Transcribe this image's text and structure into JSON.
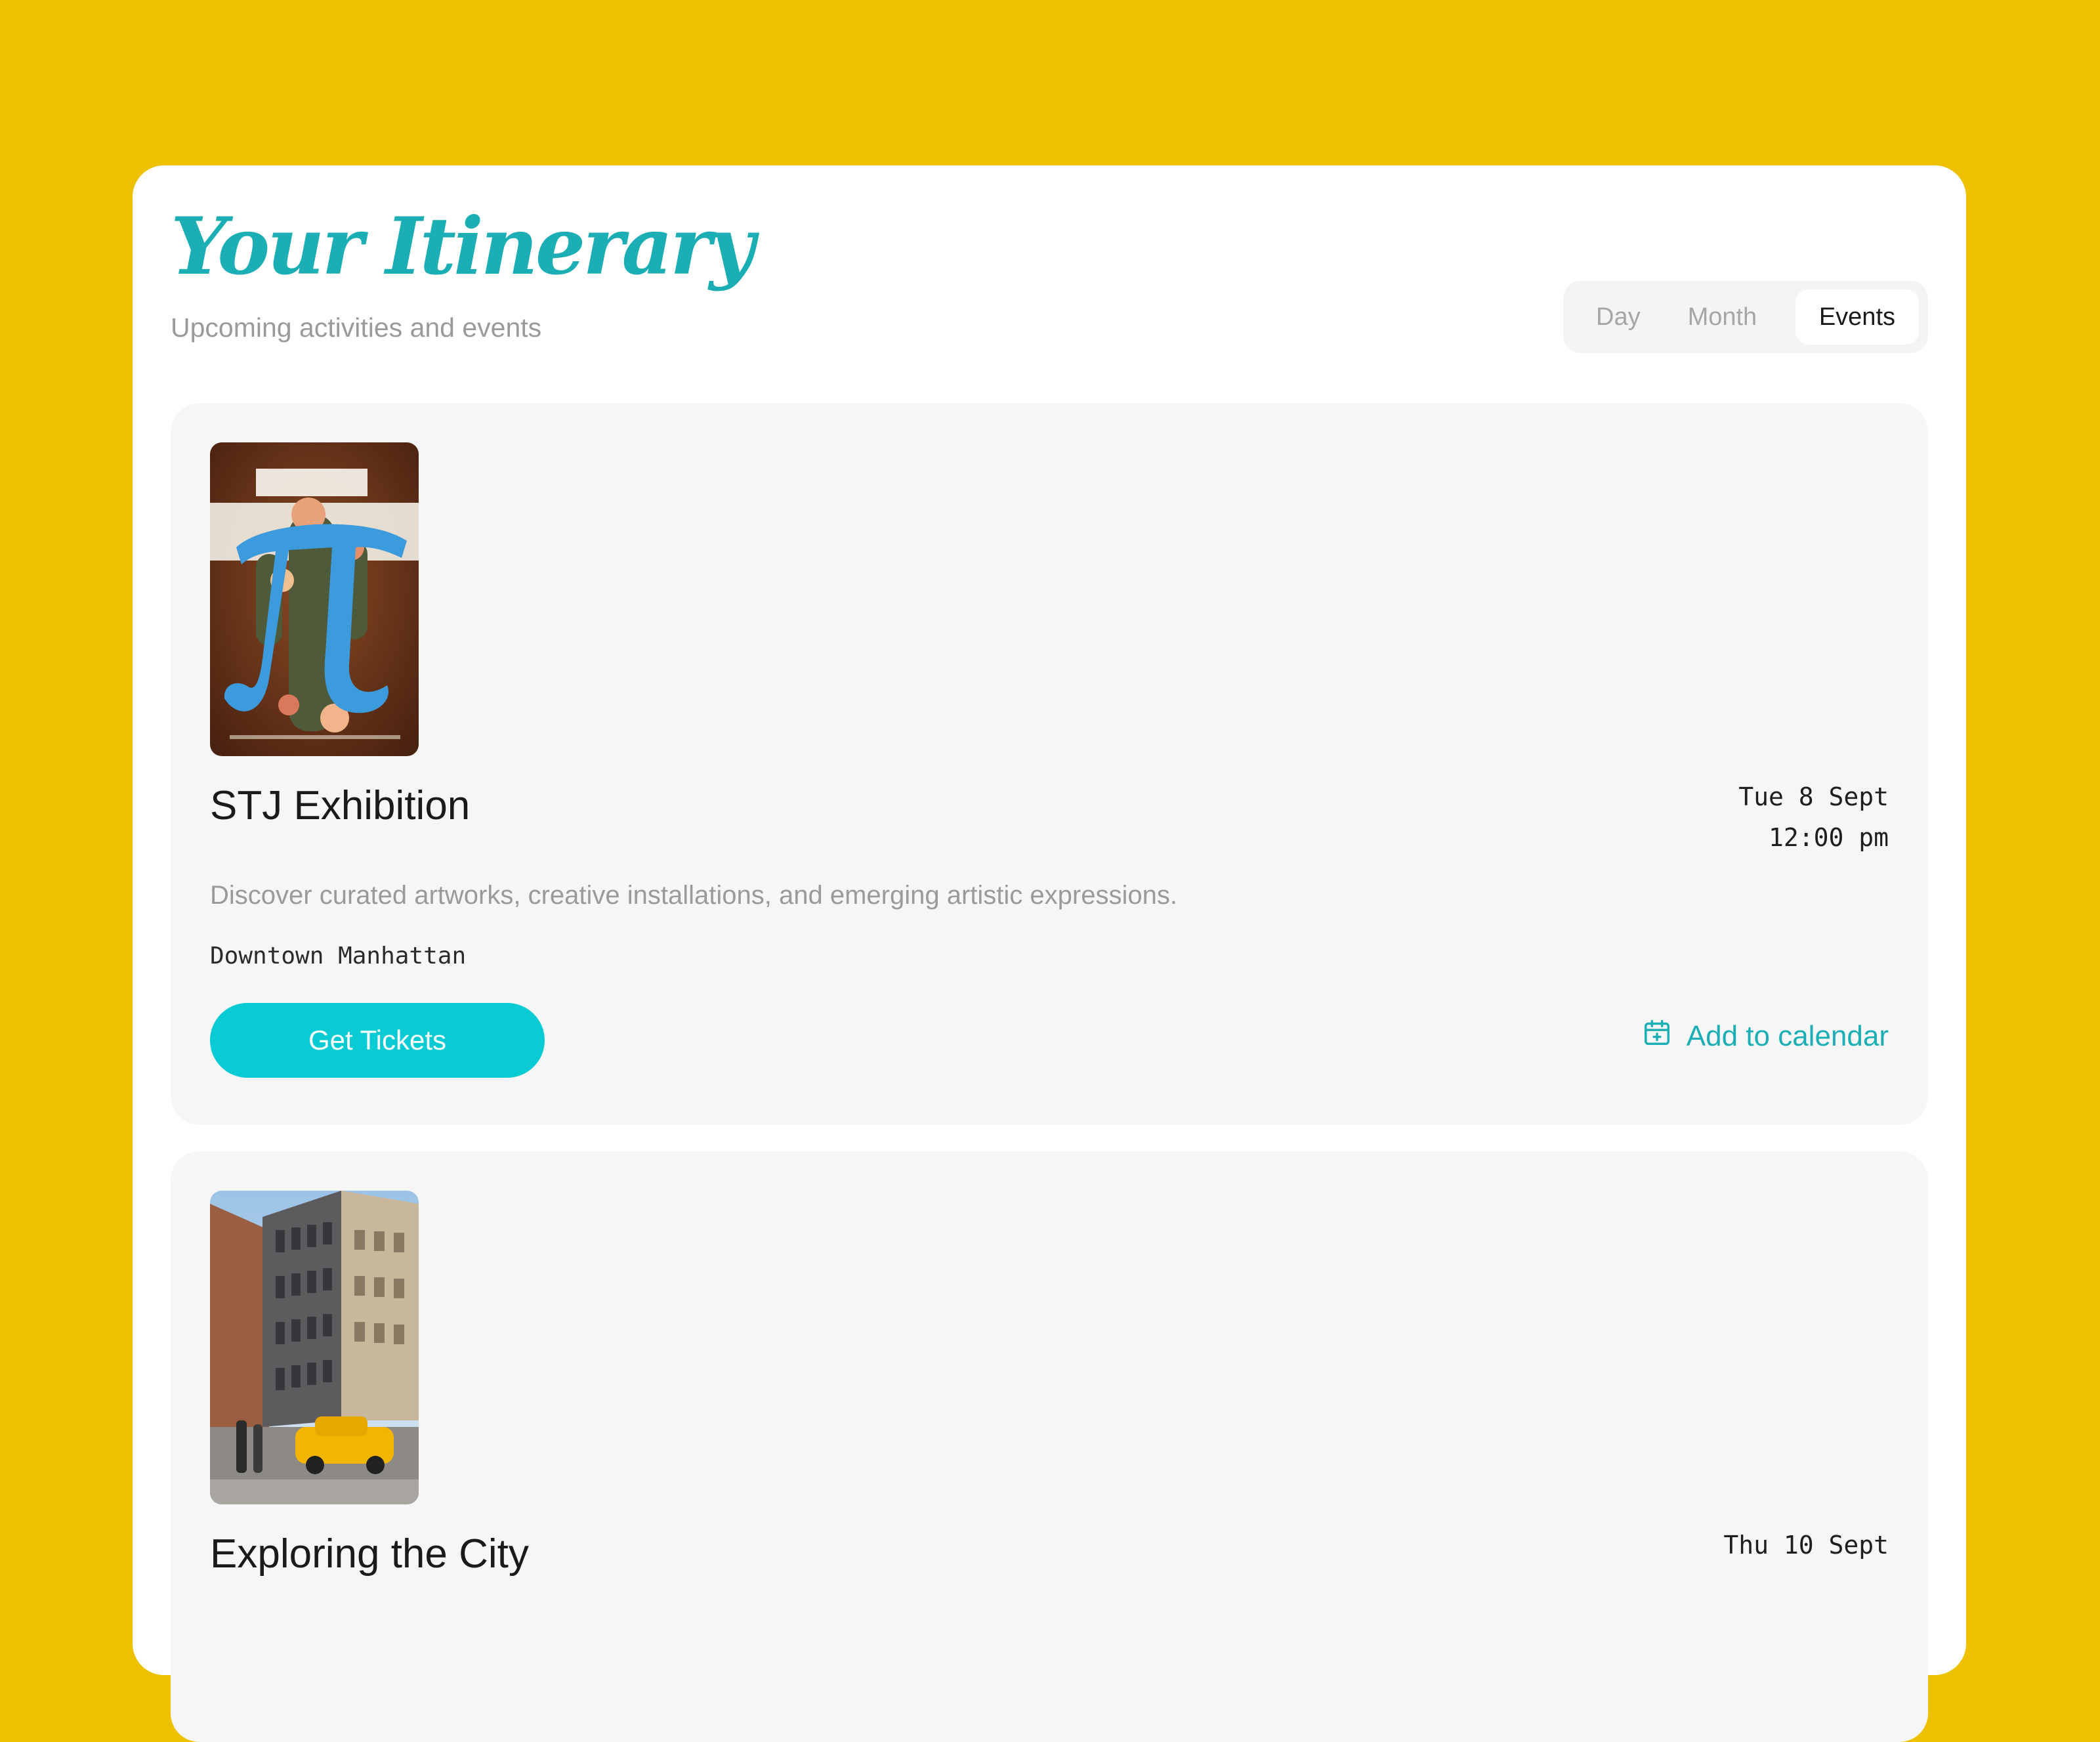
{
  "header": {
    "title": "Your Itinerary",
    "subtitle": "Upcoming activities and events"
  },
  "view_tabs": [
    {
      "label": "Day",
      "active": false
    },
    {
      "label": "Month",
      "active": false
    },
    {
      "label": "Events",
      "active": true
    }
  ],
  "events": [
    {
      "title": "STJ Exhibition",
      "date": "Tue 8 Sept",
      "time": "12:00 pm",
      "description": "Discover curated artworks, creative installations, and emerging artistic expressions.",
      "location": "Downtown Manhattan",
      "primary_action": "Get Tickets",
      "secondary_action": "Add to calendar",
      "secondary_icon": "calendar-plus-icon",
      "image": "poster-image"
    },
    {
      "title": "Exploring the City",
      "date": "Thu 10 Sept",
      "image": "city-street-image"
    }
  ],
  "colors": {
    "background": "#EEC100",
    "accent": "#1BAFB5",
    "button": "#08CBD4",
    "card": "#F6F6F6"
  }
}
